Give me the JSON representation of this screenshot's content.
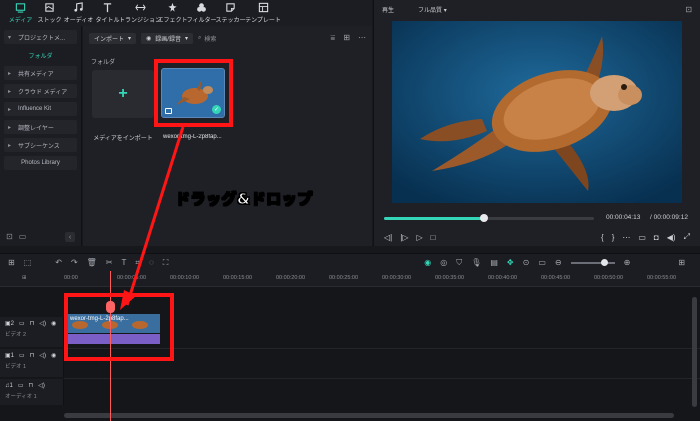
{
  "toolbar": {
    "items": [
      {
        "label": "メディア",
        "icon": "media-icon",
        "active": true
      },
      {
        "label": "ストック",
        "icon": "stock-icon"
      },
      {
        "label": "オーディオ",
        "icon": "music-icon"
      },
      {
        "label": "タイトル",
        "icon": "title-icon"
      },
      {
        "label": "トランジション",
        "icon": "transition-icon"
      },
      {
        "label": "エフェクト",
        "icon": "effect-icon"
      },
      {
        "label": "フィルター",
        "icon": "filter-icon"
      },
      {
        "label": "ステッカー",
        "icon": "sticker-icon"
      },
      {
        "label": "テンプレート",
        "icon": "template-icon"
      }
    ]
  },
  "sidebar": {
    "project": "プロジェクトメ...",
    "folder": "フォルダ",
    "items": [
      "共有メディア",
      "クラウド メディア",
      "Influence Kit",
      "調整レイヤー",
      "サブシーケンス"
    ],
    "photos": "Photos Library"
  },
  "media": {
    "import_button": "インポート",
    "record_button": "録画/録音",
    "search_placeholder": "検索",
    "folder_label": "フォルダ",
    "import_tile_label": "メディアをインポート",
    "clip_label": "wexor-tmg-L-2p8fap..."
  },
  "preview": {
    "play_label": "再生",
    "quality": "フル品質",
    "current_time": "00:00:04:13",
    "total_time": "/ 00:00:09:12",
    "progress": 0.475
  },
  "timeline": {
    "ticks": [
      "00:00",
      "00:00:05:00",
      "00:00:10:00",
      "00:00:15:00",
      "00:00:20:00",
      "00:00:25:00",
      "00:00:30:00",
      "00:00:35:00",
      "00:00:40:00",
      "00:00:45:00",
      "00:00:50:00",
      "00:00:55:00",
      "00:01:00:00"
    ],
    "tracks": [
      {
        "num": "2",
        "name": "ビデオ 2"
      },
      {
        "num": "1",
        "name": "ビデオ 1"
      },
      {
        "num": "1",
        "name": "オーディオ 1"
      }
    ],
    "clip_name": "wexor-tmg-L-2p8fap..."
  },
  "annotation": {
    "callout": "ドラッグ&ドロップ",
    "highlight_color": "#ff1515"
  }
}
